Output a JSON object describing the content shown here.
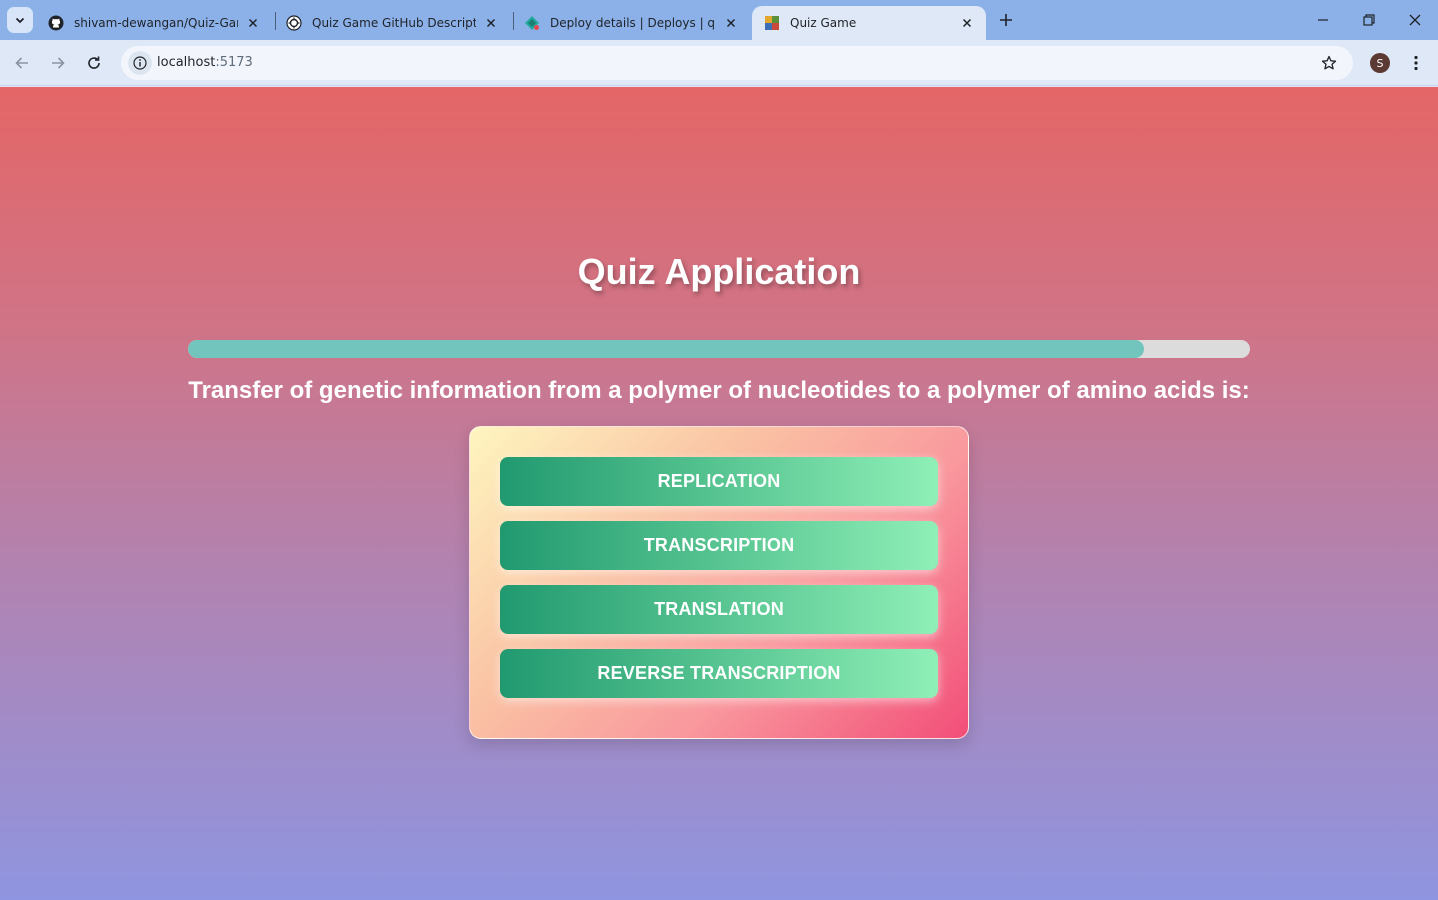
{
  "browser": {
    "tabs": [
      {
        "title": "shivam-dewangan/Quiz-Game:",
        "favicon": "github-icon"
      },
      {
        "title": "Quiz Game GitHub Description",
        "favicon": "chatgpt-icon"
      },
      {
        "title": "Deploy details | Deploys | quiz-g",
        "favicon": "netlify-icon"
      },
      {
        "title": "Quiz Game",
        "favicon": "app-favicon-icon",
        "active": true
      }
    ],
    "url_host": "localhost",
    "url_port": ":5173",
    "profile_initial": "S"
  },
  "page": {
    "title": "Quiz Application",
    "progress_percent": 90,
    "question": "Transfer of genetic information from a polymer of nucleotides to a polymer of amino acids is:",
    "options": [
      "REPLICATION",
      "TRANSCRIPTION",
      "TRANSLATION",
      "REVERSE TRANSCRIPTION"
    ]
  },
  "colors": {
    "background_top": "#e46666",
    "background_bottom": "#8f95e0",
    "progress_fill": "#72c5bd",
    "progress_track": "#dcdcdc",
    "option_start": "#219970",
    "option_end": "#8fefb7"
  }
}
